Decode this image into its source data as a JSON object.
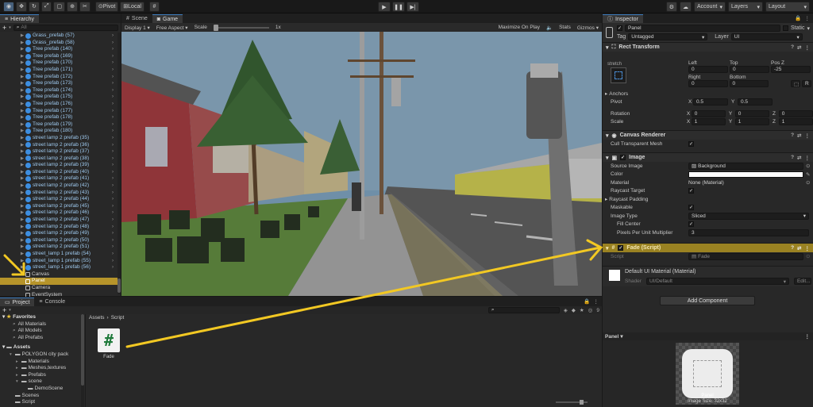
{
  "toolbar": {
    "pivot_label": "Pivot",
    "local_label": "Local",
    "account_label": "Account",
    "layers_label": "Layers",
    "layout_label": "Layout"
  },
  "hierarchy": {
    "tab_label": "Hierarchy",
    "search_placeholder": "All",
    "prefab_items": [
      "Grass_prefab (57)",
      "Grass_prefab (58)",
      "Tree prefab (140)",
      "Tree prefab (169)",
      "Tree prefab (170)",
      "Tree prefab (171)",
      "Tree prefab (172)",
      "Tree prefab (173)",
      "Tree prefab (174)",
      "Tree prefab (175)",
      "Tree prefab (176)",
      "Tree prefab (177)",
      "Tree prefab (178)",
      "Tree prefab (179)",
      "Tree prefab (180)",
      "street lamp 2 prefab (35)",
      "street lamp 2 prefab (36)",
      "street lamp 2 prefab (37)",
      "street lamp 2 prefab (38)",
      "street lamp 2 prefab (39)",
      "street lamp 2 prefab (40)",
      "street lamp 2 prefab (41)",
      "street lamp 2 prefab (42)",
      "street lamp 2 prefab (43)",
      "street lamp 2 prefab (44)",
      "street lamp 2 prefab (45)",
      "street lamp 2 prefab (46)",
      "street lamp 2 prefab (47)",
      "street lamp 2 prefab (48)",
      "street lamp 2 prefab (49)",
      "street lamp 2 prefab (50)",
      "street lamp 2 prefab (51)",
      "street_lamp 1 prefab (54)",
      "street_lamp 1 prefab (55)",
      "street_lamp 1 prefab (56)"
    ],
    "canvas_label": "Canvas",
    "panel_label": "Panel",
    "camera_label": "Camera",
    "eventsystem_label": "EventSystem"
  },
  "scene": {
    "scene_tab": "Scene",
    "game_tab": "Game",
    "display_label": "Display 1",
    "aspect_label": "Free Aspect",
    "scale_label": "Scale",
    "scale_value": "1x",
    "maximize_label": "Maximize On Play",
    "stats_label": "Stats",
    "gizmos_label": "Gizmos"
  },
  "project": {
    "project_tab": "Project",
    "console_tab": "Console",
    "hidden_count": "9",
    "favorites_label": "Favorites",
    "favorites": [
      "All Materials",
      "All Models",
      "All Prefabs"
    ],
    "assets_label": "Assets",
    "tree": [
      "POLYGON city pack",
      "Materials",
      "Meshes,textures",
      "Prefabs",
      "scene",
      "DemoScene",
      "Scenes",
      "Script"
    ],
    "breadcrumb_root": "Assets",
    "breadcrumb_leaf": "Script",
    "file_name": "Fade"
  },
  "inspector": {
    "tab_label": "Inspector",
    "object_name": "Panel",
    "static_label": "Static",
    "tag_label": "Tag",
    "tag_value": "Untagged",
    "layer_label": "Layer",
    "layer_value": "UI",
    "rect_transform": "Rect Transform",
    "stretch_label": "stretch",
    "left_label": "Left",
    "left_value": "0",
    "top_label": "Top",
    "top_value": "0",
    "posz_label": "Pos Z",
    "posz_value": "-25",
    "right_label": "Right",
    "right_value": "0",
    "bottom_label": "Bottom",
    "bottom_value": "0",
    "anchors_label": "Anchors",
    "pivot_label": "Pivot",
    "pivot_x": "0.5",
    "pivot_y": "0.5",
    "rotation_label": "Rotation",
    "rot_x": "0",
    "rot_y": "0",
    "rot_z": "0",
    "scale_label": "Scale",
    "scale_x": "1",
    "scale_y": "1",
    "scale_z": "1",
    "canvas_renderer": "Canvas Renderer",
    "cull_label": "Cull Transparent Mesh",
    "image_label": "Image",
    "source_image_label": "Source Image",
    "source_image_value": "Background",
    "color_label": "Color",
    "material_label": "Material",
    "material_value": "None (Material)",
    "raycast_target_label": "Raycast Target",
    "raycast_padding_label": "Raycast Padding",
    "maskable_label": "Maskable",
    "image_type_label": "Image Type",
    "image_type_value": "Sliced",
    "fill_center_label": "Fill Center",
    "ppu_label": "Pixels Per Unit Multiplier",
    "ppu_value": "3",
    "fade_script_label": "Fade (Script)",
    "script_label": "Script",
    "script_value": "Fade",
    "default_material": "Default UI Material (Material)",
    "shader_label": "Shader",
    "shader_value": "UI/Default",
    "edit_label": "Edit...",
    "add_component": "Add Component",
    "preview_title": "Panel",
    "preview_caption": "Panel",
    "preview_size": "Image Size: 32x32"
  },
  "colors": {
    "highlight": "#c9a42a",
    "arrow": "#f2c823",
    "prefab_text": "#9ec9ee"
  }
}
